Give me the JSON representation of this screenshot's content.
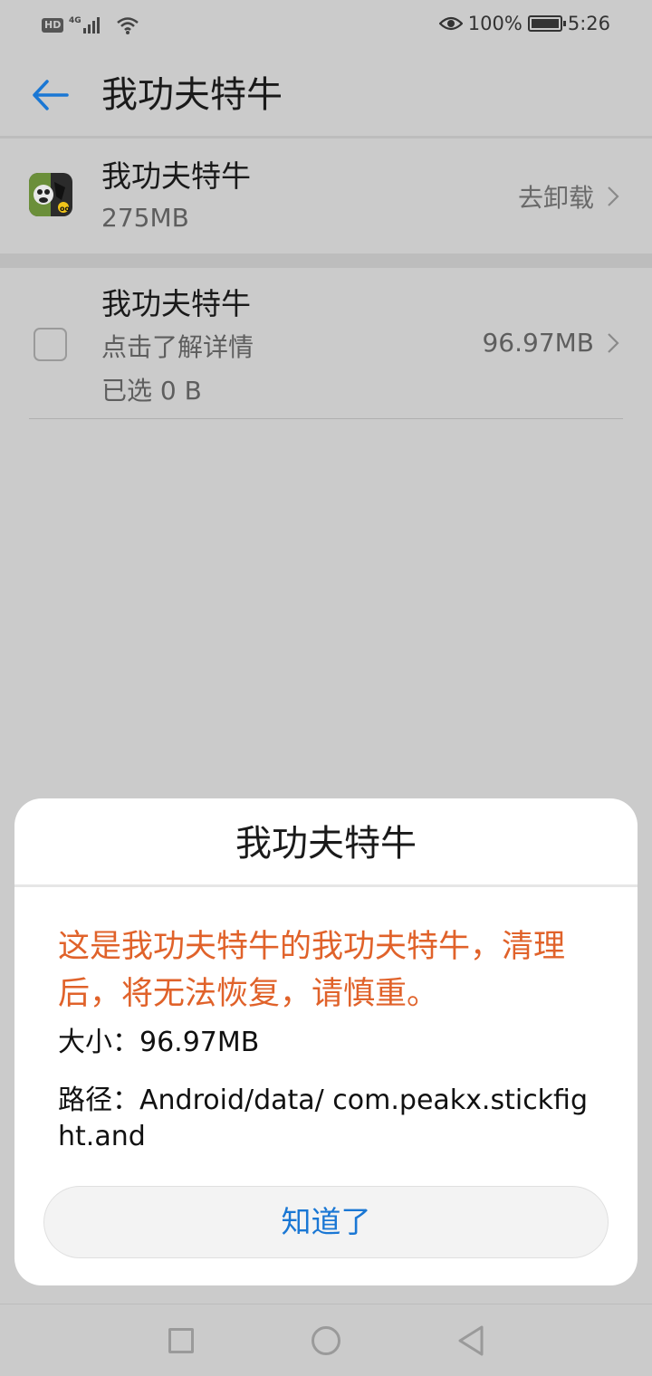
{
  "status_bar": {
    "hd": "HD",
    "network": "4G",
    "battery_percent": "100%",
    "time": "5:26",
    "icons": [
      "hd-icon",
      "signal-icon",
      "wifi-icon",
      "eye-icon",
      "battery-icon"
    ]
  },
  "header": {
    "back_icon": "back-arrow-icon",
    "title": "我功夫特牛"
  },
  "app": {
    "icon": "app-icon",
    "name": "我功夫特牛",
    "size": "275MB",
    "action_label": "去卸载"
  },
  "item": {
    "title": "我功夫特牛",
    "description": "点击了解详情",
    "selected": "已选 0 B",
    "size": "96.97MB",
    "checked": false
  },
  "dialog": {
    "title": "我功夫特牛",
    "warning": "这是我功夫特牛的我功夫特牛，清理后，将无法恢复，请慎重。",
    "size_line": "大小：96.97MB",
    "path_line": "路径：Android/data/ com.peakx.stickfight.and",
    "button_label": "知道了"
  },
  "colors": {
    "accent": "#1a77d4",
    "warning": "#e0622a",
    "scrim_background": "#cbcbcb"
  },
  "nav": {
    "icons": [
      "recents-square-icon",
      "home-circle-icon",
      "back-triangle-icon"
    ]
  }
}
